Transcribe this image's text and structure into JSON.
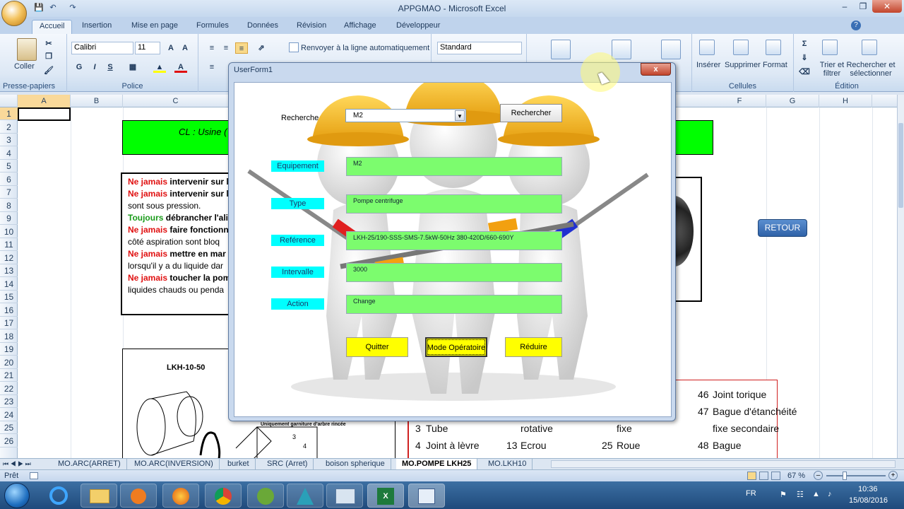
{
  "window": {
    "title": "APPGMAO - Microsoft Excel"
  },
  "ribbon": {
    "tabs": [
      "Accueil",
      "Insertion",
      "Mise en page",
      "Formules",
      "Données",
      "Révision",
      "Affichage",
      "Développeur"
    ],
    "paste_label": "Coller",
    "clipboard_group": "Presse-papiers",
    "font_name": "Calibri",
    "font_size": "11",
    "font_group": "Police",
    "wrap_text": "Renvoyer à la ligne automatiquement",
    "number_format": "Standard",
    "insert_label": "Insérer",
    "delete_label": "Supprimer",
    "format_label": "Format",
    "cells_group": "Cellules",
    "sort_label": "Trier et filtrer",
    "find_label": "Rechercher et sélectionner",
    "edition_group": "Édition"
  },
  "grid": {
    "columns": [
      "A",
      "B",
      "C",
      "F",
      "G",
      "H"
    ],
    "rows": [
      "1",
      "2",
      "3",
      "4",
      "5",
      "6",
      "7",
      "8",
      "9",
      "10",
      "11",
      "12",
      "13",
      "14",
      "15",
      "16",
      "17",
      "18",
      "19",
      "20",
      "21",
      "22",
      "23",
      "24",
      "25",
      "26"
    ]
  },
  "sheet": {
    "banner_text": "CL : Usine (",
    "retour_label": "RETOUR",
    "drawing_title": "LKH-10-50",
    "drawing_caption": "Uniquement garniture d'arbre rincée",
    "warnings": {
      "l1_a": "Ne jamais",
      "l1_b": " intervenir sur l",
      "l2_a": "Ne jamais",
      "l2_b": " intervenir sur l",
      "l3": "sont sous pression.",
      "l4_a": "Toujours",
      "l4_b": " débrancher l'ali",
      "l5_a": "Ne jamais",
      "l5_b": " faire fonctionn",
      "l6": "côté aspiration sont bloq",
      "l7_a": "Ne jamais",
      "l7_b": " mettre en mar",
      "l8": "lorsqu'il y a du liquide dar",
      "l9_a": "Ne jamais",
      "l9_b": " toucher la pom",
      "l10": "liquides chauds ou penda"
    },
    "parts": {
      "p46_num": "46",
      "p46": "Joint torique",
      "p47_num": "47",
      "p47a": "Bague d'étanchéité",
      "p47b": "fixe secondaire",
      "p48_num": "48",
      "p48": "Bague",
      "p3_num": "3",
      "p3": "Tube",
      "p3b": "rotative",
      "p3c": "fixe",
      "p4_num": "4",
      "p4": "Joint à lèvre",
      "p13_num": "13",
      "p13": "Ecrou",
      "p25_num": "25",
      "p25": "Roue"
    }
  },
  "userform": {
    "title": "UserForm1",
    "close": "x",
    "search_label": "Recherche",
    "search_value": "M2",
    "search_button": "Rechercher",
    "fields": [
      {
        "label": "Equipement",
        "value": "M2"
      },
      {
        "label": "Type",
        "value": "Pompe centrifuge"
      },
      {
        "label": "Reférence",
        "value": "LKH-25/190-SSS-SMS-7.5kW-50Hz 380-420D/660-690Y"
      },
      {
        "label": "Intervalle",
        "value": "3000"
      },
      {
        "label": "Action",
        "value": "Change"
      }
    ],
    "buttons": {
      "quit": "Quitter",
      "mode": "Mode Opératoire",
      "reduce": "Réduire"
    }
  },
  "sheet_tabs": [
    "MO.ARC(ARRET)",
    "MO.ARC(INVERSION)",
    "burket",
    "SRC (Arret)",
    "boison spherique",
    "MO.POMPE LKH25",
    "MO.LKH10"
  ],
  "status": {
    "ready": "Prêt",
    "zoom": "67 %"
  },
  "taskbar": {
    "lang": "FR",
    "time": "10:36",
    "date": "15/08/2016"
  }
}
